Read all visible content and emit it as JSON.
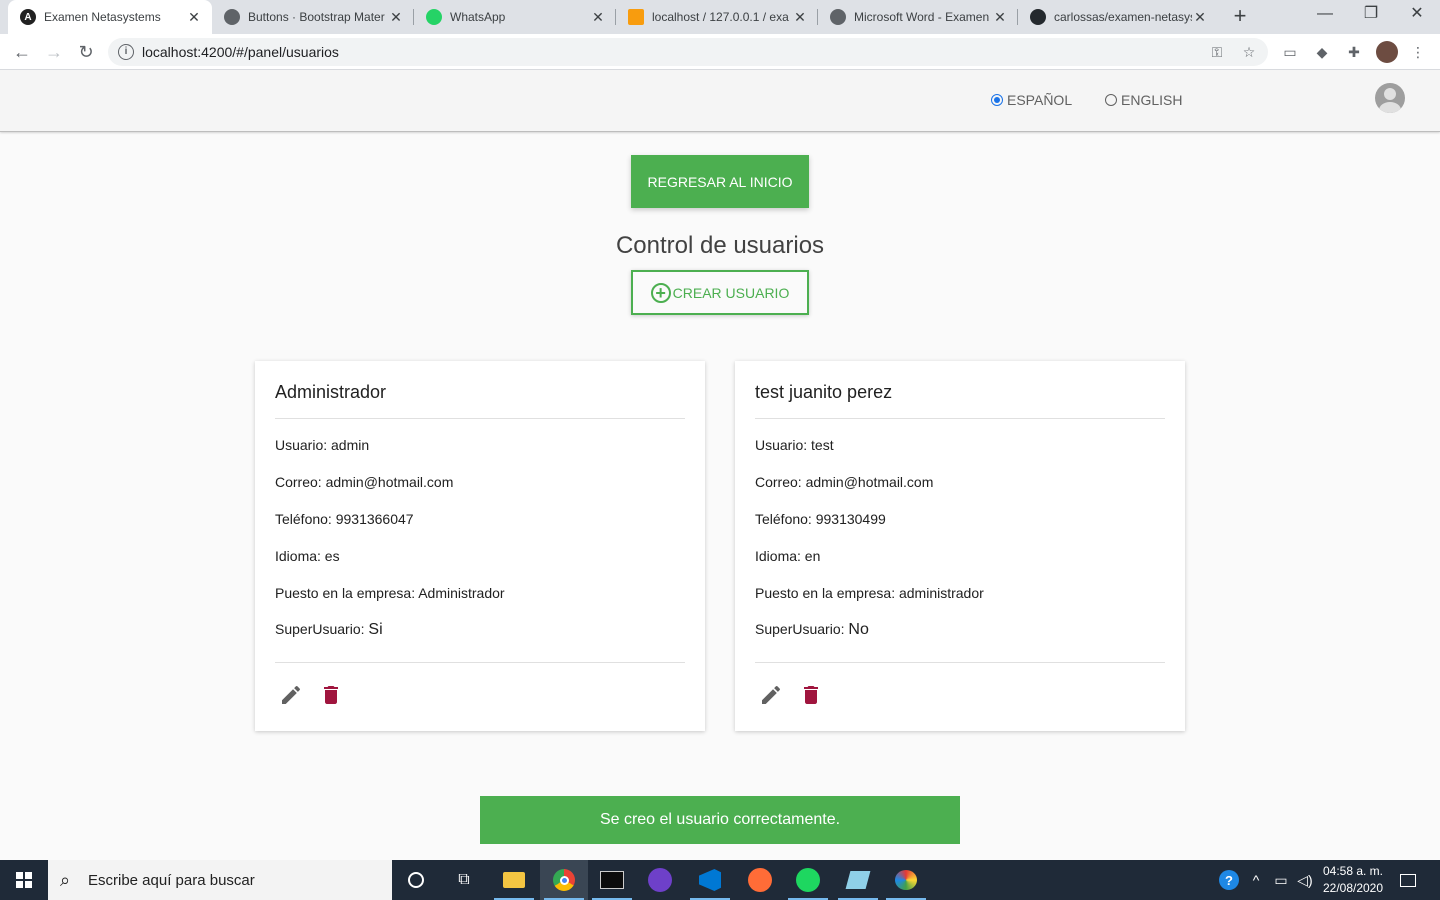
{
  "browser": {
    "tabs": [
      {
        "title": "Examen Netasystems",
        "icon": "angular-icon",
        "active": true
      },
      {
        "title": "Buttons · Bootstrap Mater",
        "icon": "globe-icon"
      },
      {
        "title": "WhatsApp",
        "icon": "whatsapp-icon"
      },
      {
        "title": "localhost / 127.0.0.1 / exa",
        "icon": "phpmyadmin-icon"
      },
      {
        "title": "Microsoft Word - Examen",
        "icon": "globe-icon"
      },
      {
        "title": "carlossas/examen-netasys",
        "icon": "github-icon"
      }
    ],
    "url": "localhost:4200/#/panel/usuarios",
    "close_glyph": "✕",
    "new_tab_glyph": "+"
  },
  "header": {
    "languages": [
      {
        "label": "ESPAÑOL",
        "checked": true
      },
      {
        "label": "ENGLISH",
        "checked": false
      }
    ]
  },
  "main": {
    "home_button": "REGRESAR AL INICIO",
    "title": "Control de usuarios",
    "create_button": "CREAR USUARIO",
    "cards": [
      {
        "name": "Administrador",
        "usuario": "Usuario: admin",
        "correo": "Correo: admin@hotmail.com",
        "telefono": "Teléfono: 9931366047",
        "idioma": "Idioma: es",
        "puesto": "Puesto en la empresa: Administrador",
        "super_label": "SuperUsuario: ",
        "super_value": "Si"
      },
      {
        "name": "test juanito perez",
        "usuario": "Usuario: test",
        "correo": "Correo: admin@hotmail.com",
        "telefono": "Teléfono: 993130499",
        "idioma": "Idioma: en",
        "puesto": "Puesto en la empresa: administrador",
        "super_label": "SuperUsuario: ",
        "super_value": "No"
      }
    ]
  },
  "snackbar": {
    "message": "Se creo el usuario correctamente."
  },
  "taskbar": {
    "search_placeholder": "Escribe aquí para buscar",
    "time": "04:58 a. m.",
    "date": "22/08/2020"
  },
  "colors": {
    "primary": "#4caf50",
    "delete": "#a0153e",
    "edit": "#616161",
    "radio_checked": "#1a73e8"
  }
}
